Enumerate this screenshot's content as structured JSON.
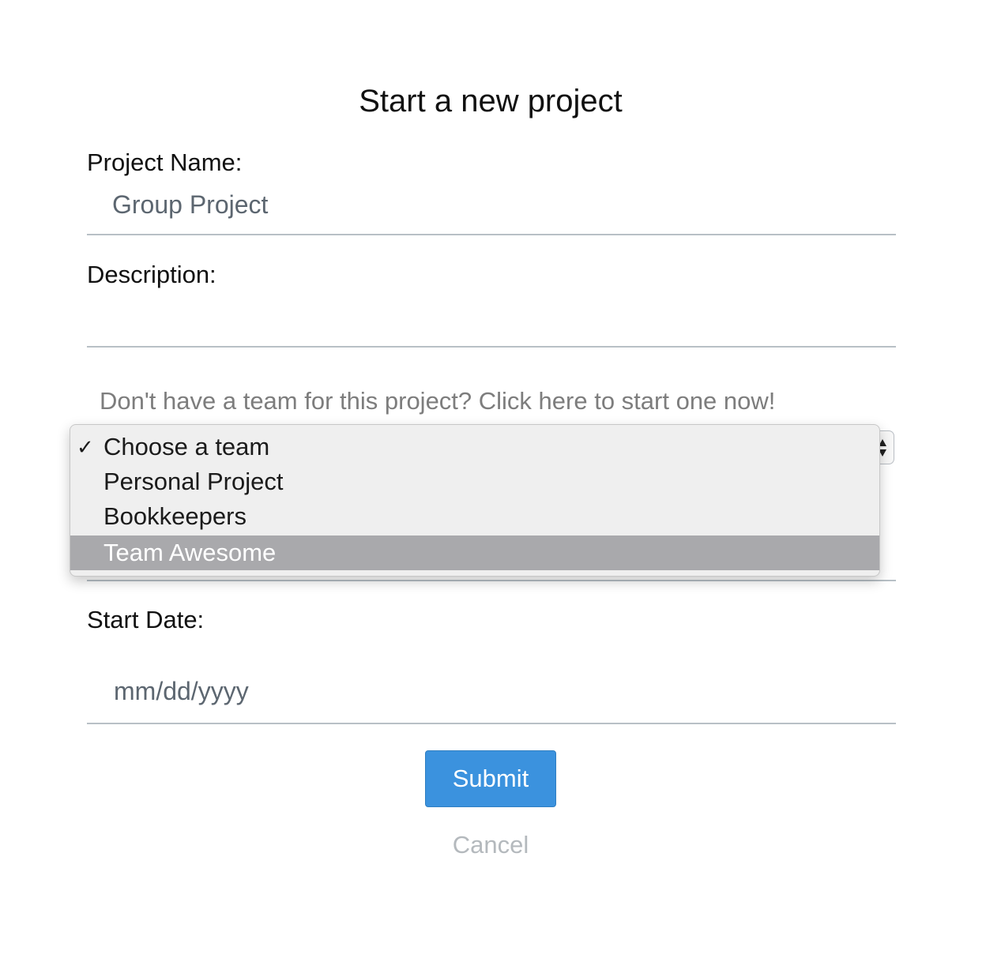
{
  "page": {
    "title": "Start a new project"
  },
  "form": {
    "project_name": {
      "label": "Project Name:",
      "value": "Group Project"
    },
    "description": {
      "label": "Description:",
      "value": ""
    },
    "team_link_text": "Don't have a team for this project? Click here to start one now!",
    "team_select": {
      "selected": "Choose a team",
      "highlighted": "Team Awesome",
      "options": [
        {
          "label": "Choose a team",
          "checked": true
        },
        {
          "label": "Personal Project",
          "checked": false
        },
        {
          "label": "Bookkeepers",
          "checked": false
        },
        {
          "label": "Team Awesome",
          "checked": false
        }
      ],
      "checkmark": "✓"
    },
    "start_date": {
      "label": "Start Date:",
      "placeholder": "mm/dd/yyyy"
    },
    "submit_label": "Submit",
    "cancel_label": "Cancel"
  },
  "colors": {
    "submit_bg": "#3b92de",
    "highlight_bg": "#a9a9ac",
    "dropdown_bg": "#efefef",
    "link_text": "#7d7d7d",
    "cancel_text": "#b4b9bd"
  }
}
